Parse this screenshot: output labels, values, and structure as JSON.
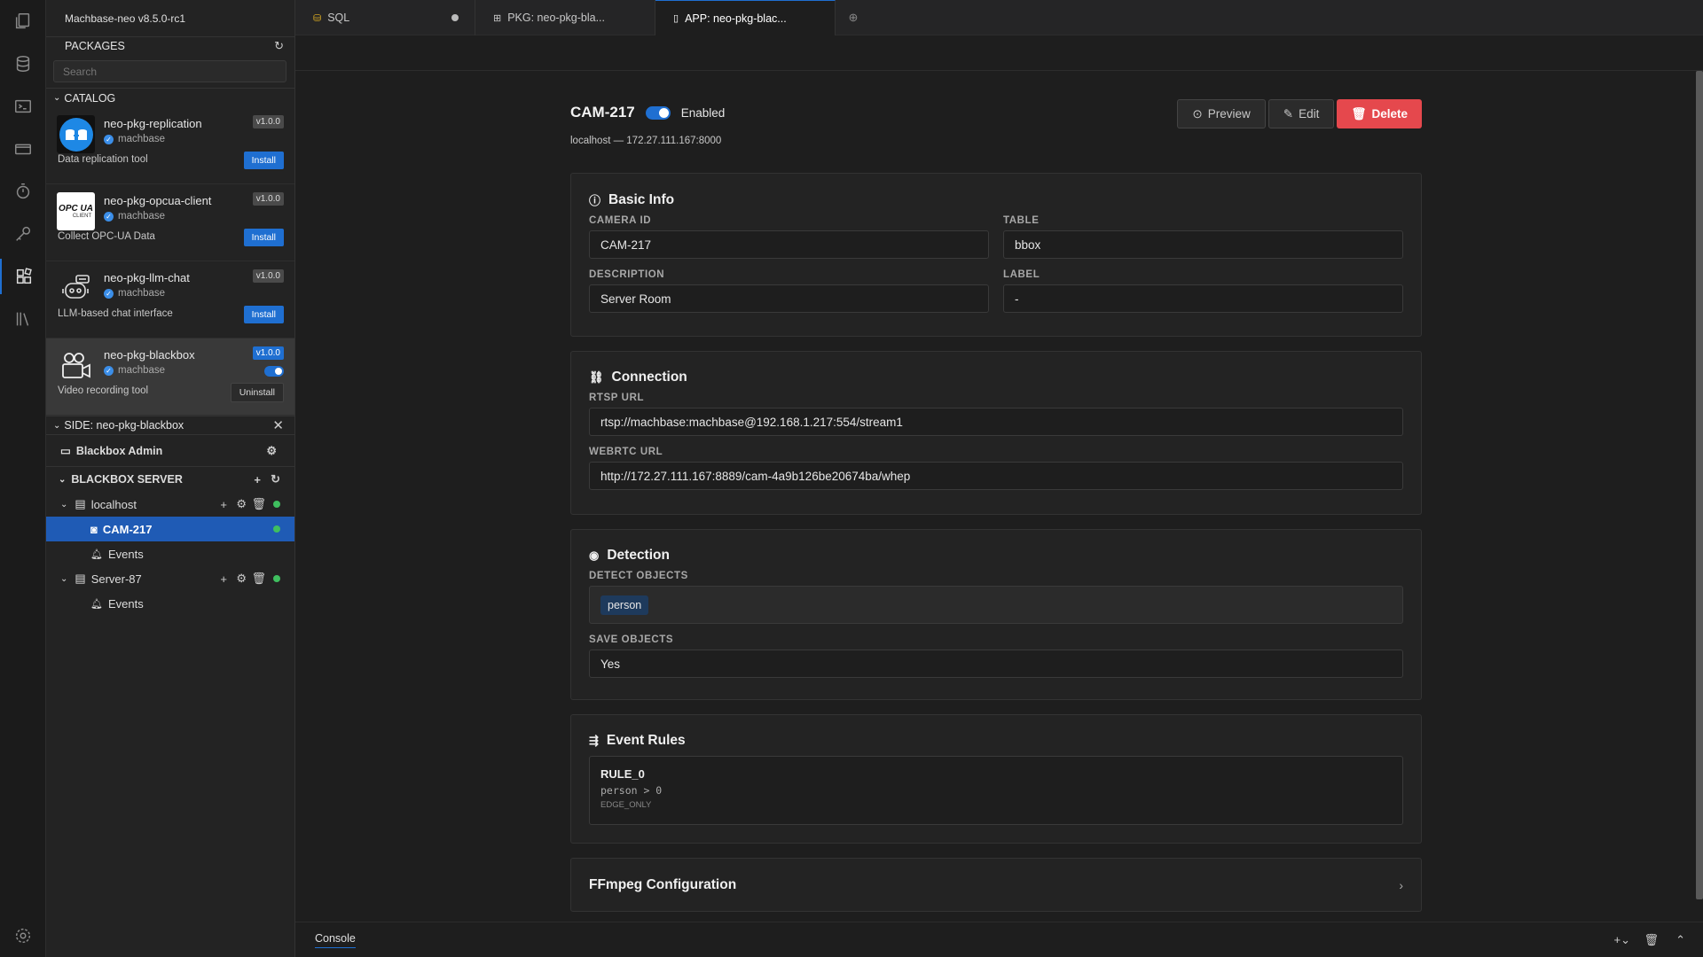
{
  "app": {
    "title": "Machbase-neo v8.5.0-rc1"
  },
  "packages": {
    "header": "PACKAGES",
    "search_placeholder": "Search",
    "catalog_label": "CATALOG",
    "items": [
      {
        "name": "neo-pkg-replication",
        "author": "machbase",
        "version": "v1.0.0",
        "desc": "Data replication tool",
        "action": "Install"
      },
      {
        "name": "neo-pkg-opcua-client",
        "author": "machbase",
        "version": "v1.0.0",
        "desc": "Collect OPC-UA Data",
        "action": "Install",
        "logo_text": "OPC UA",
        "logo_sub": "CLIENT"
      },
      {
        "name": "neo-pkg-llm-chat",
        "author": "machbase",
        "version": "v1.0.0",
        "desc": "LLM-based chat interface",
        "action": "Install"
      },
      {
        "name": "neo-pkg-blackbox",
        "author": "machbase",
        "version": "v1.0.0",
        "desc": "Video recording tool",
        "action": "Uninstall"
      }
    ]
  },
  "side": {
    "title": "SIDE: neo-pkg-blackbox",
    "admin_label": "Blackbox Admin",
    "server_section": "BLACKBOX SERVER",
    "servers": [
      {
        "name": "localhost",
        "children": [
          {
            "name": "CAM-217"
          },
          {
            "name": "Events"
          }
        ]
      },
      {
        "name": "Server-87",
        "children": [
          {
            "name": "Events"
          }
        ]
      }
    ]
  },
  "tabs": [
    {
      "label": "SQL"
    },
    {
      "label": "PKG: neo-pkg-bla..."
    },
    {
      "label": "APP: neo-pkg-blac..."
    }
  ],
  "camera": {
    "name": "CAM-217",
    "enabled_label": "Enabled",
    "host_line": "localhost — 172.27.111.167:8000",
    "buttons": {
      "preview": "Preview",
      "edit": "Edit",
      "delete": "Delete"
    }
  },
  "basic_info": {
    "title": "Basic Info",
    "camera_id_label": "CAMERA ID",
    "camera_id": "CAM-217",
    "table_label": "TABLE",
    "table": "bbox",
    "description_label": "DESCRIPTION",
    "description": "Server Room",
    "label_label": "LABEL",
    "label": "-"
  },
  "connection": {
    "title": "Connection",
    "rtsp_label": "RTSP URL",
    "rtsp": "rtsp://machbase:machbase@192.168.1.217:554/stream1",
    "webrtc_label": "WEBRTC URL",
    "webrtc": "http://172.27.111.167:8889/cam-4a9b126be20674ba/whep"
  },
  "detection": {
    "title": "Detection",
    "detect_label": "DETECT OBJECTS",
    "detect_tag": "person",
    "save_label": "SAVE OBJECTS",
    "save": "Yes"
  },
  "event_rules": {
    "title": "Event Rules",
    "rule_name": "RULE_0",
    "rule_expr": "person > 0",
    "rule_mode": "EDGE_ONLY"
  },
  "ffmpeg": {
    "title": "FFmpeg Configuration"
  },
  "console": {
    "label": "Console"
  },
  "colors": {
    "accent": "#1f6fd1",
    "delete": "#e5484d",
    "status_ok": "#3fbf5f"
  }
}
